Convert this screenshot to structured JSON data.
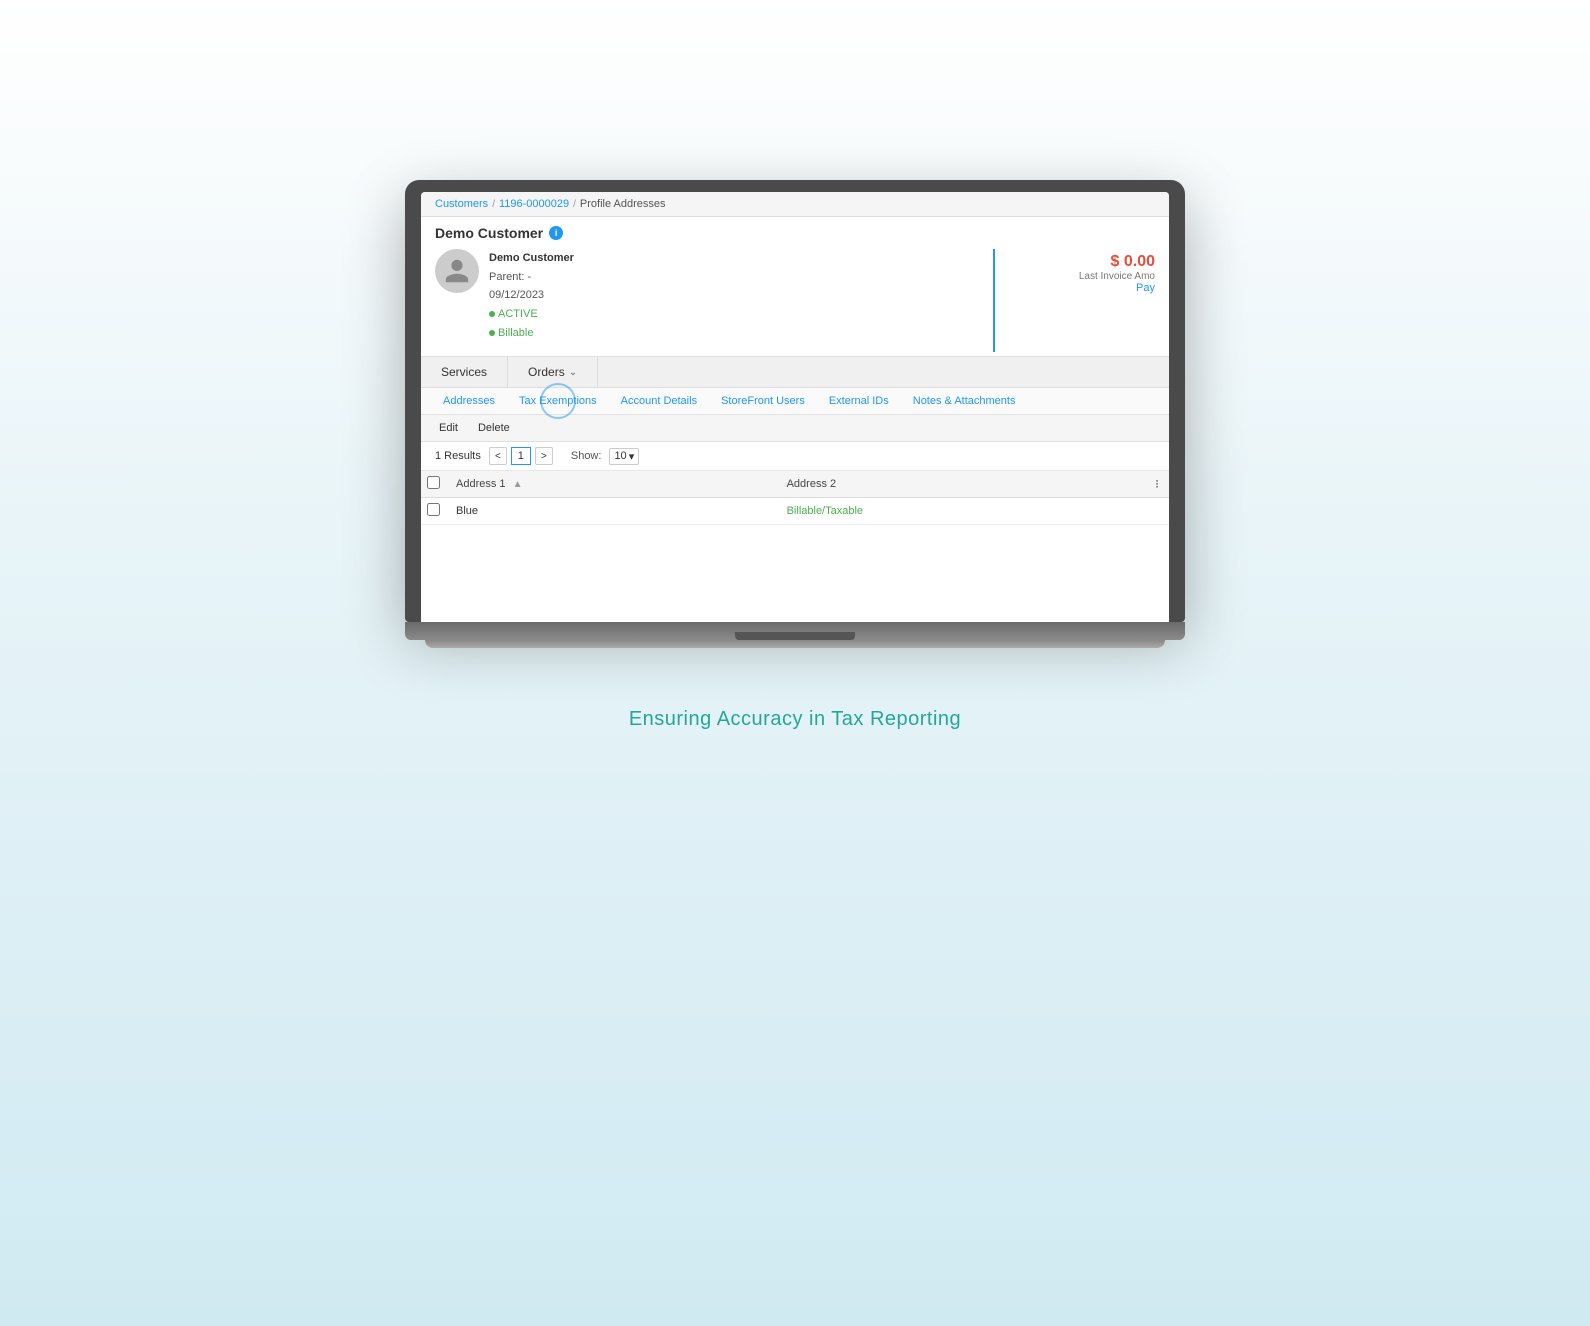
{
  "breadcrumb": {
    "customers": "Customers",
    "account_id": "1196-0000029",
    "current": "Profile Addresses",
    "sep": "/"
  },
  "customer": {
    "title": "Demo Customer",
    "info_icon": "i",
    "name": "Demo Customer",
    "parent_label": "Parent: -",
    "date": "09/12/2023",
    "status_active": "ACTIVE",
    "status_billable": "Billable",
    "balance": "$ 0.00",
    "balance_label": "Last Invoice Amo",
    "pay_label": "Pay"
  },
  "tabs_row1": [
    {
      "label": "Services",
      "active": false
    },
    {
      "label": "Orders",
      "active": false,
      "has_chevron": true
    }
  ],
  "tabs_row2": [
    {
      "label": "Addresses",
      "active": false
    },
    {
      "label": "Tax Exemptions",
      "active": true,
      "highlighted": true
    },
    {
      "label": "Account Details",
      "active": false
    },
    {
      "label": "StoreFront Users",
      "active": false
    },
    {
      "label": "External IDs",
      "active": false
    },
    {
      "label": "Notes & Attachments",
      "active": false
    }
  ],
  "toolbar": {
    "edit_label": "Edit",
    "delete_label": "Delete"
  },
  "table_controls": {
    "results": "1 Results",
    "page_prev": "<",
    "page_num": "1",
    "page_next": ">",
    "show_label": "Show:",
    "show_value": "10",
    "show_chevron": "▾"
  },
  "table": {
    "columns": [
      {
        "label": "Address 1",
        "has_filter": true
      },
      {
        "label": "Address 2",
        "has_filter": false
      }
    ],
    "rows": [
      {
        "address1": "Blue",
        "address2": "",
        "status": "Billable/Taxable"
      }
    ]
  },
  "tagline": "Ensuring Accuracy in Tax Reporting"
}
